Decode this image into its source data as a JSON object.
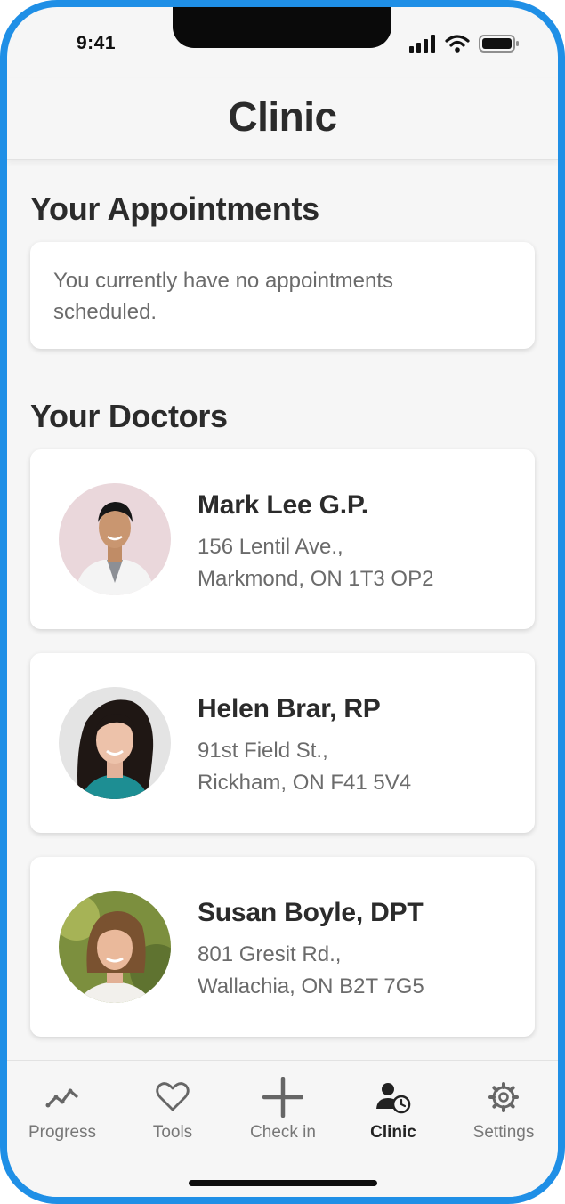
{
  "status_bar": {
    "time": "9:41"
  },
  "header": {
    "title": "Clinic"
  },
  "appointments": {
    "title": "Your Appointments",
    "empty_message": "You currently have no appointments scheduled."
  },
  "doctors": {
    "title": "Your Doctors",
    "items": [
      {
        "name": "Mark Lee G.P.",
        "address_line1": "156 Lentil Ave.,",
        "address_line2": "Markmond, ON 1T3 OP2"
      },
      {
        "name": "Helen Brar, RP",
        "address_line1": "91st Field St.,",
        "address_line2": "Rickham, ON F41 5V4"
      },
      {
        "name": "Susan Boyle, DPT",
        "address_line1": "801 Gresit Rd.,",
        "address_line2": "Wallachia, ON B2T 7G5"
      }
    ]
  },
  "tabbar": {
    "items": [
      {
        "label": "Progress",
        "icon": "trend-line-icon"
      },
      {
        "label": "Tools",
        "icon": "heart-icon"
      },
      {
        "label": "Check in",
        "icon": "plus-icon"
      },
      {
        "label": "Clinic",
        "icon": "person-clock-icon",
        "active": true
      },
      {
        "label": "Settings",
        "icon": "gear-icon"
      }
    ]
  },
  "colors": {
    "frame": "#1f8fe6",
    "background": "#f6f6f6",
    "card": "#ffffff",
    "text_primary": "#2b2b2b",
    "text_secondary": "#6b6b6b"
  }
}
